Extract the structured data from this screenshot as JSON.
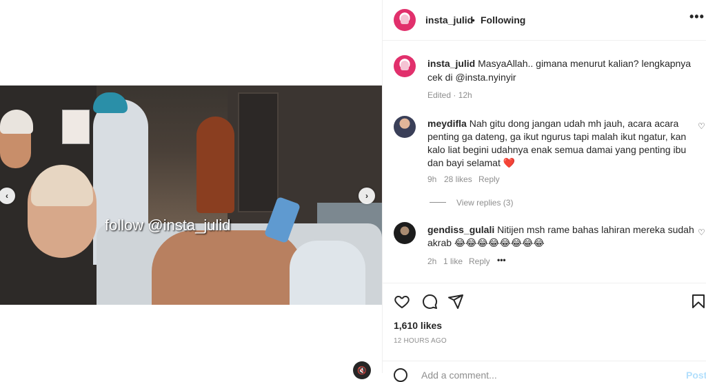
{
  "media": {
    "overlay_text": "follow @insta_julid",
    "prev_arrow": "‹",
    "next_arrow": "›",
    "audio_icon": "🔇"
  },
  "header": {
    "username": "insta_julid",
    "separator": "•",
    "following": "Following",
    "more": "•••"
  },
  "caption": {
    "username": "insta_julid",
    "text": "MasyaAllah.. gimana menurut kalian? lengkapnya cek di @insta.nyinyir",
    "meta": "Edited · 12h"
  },
  "comments": [
    {
      "username": "meydifla",
      "text": "Nah gitu dong jangan udah mh jauh, acara acara penting ga dateng, ga ikut ngurus tapi malah ikut ngatur, kan kalo liat begini udahnya enak semua damai yang penting ibu dan bayi selamat",
      "emoji": "❤️",
      "time": "9h",
      "likes": "28 likes",
      "reply": "Reply",
      "view_replies": "View replies (3)"
    },
    {
      "username": "gendiss_gulali",
      "text": "Nitijen msh rame bahas lahiran mereka sudah akrab",
      "emoji": "😂😂😂😂😂😂😂😂",
      "time": "2h",
      "likes": "1 like",
      "reply": "Reply",
      "more": "•••"
    }
  ],
  "footer": {
    "likes": "1,610 likes",
    "time_ago": "12 HOURS AGO",
    "add_comment_placeholder": "Add a comment...",
    "post": "Post"
  },
  "icons": {
    "like": "heart-icon",
    "comment": "comment-icon",
    "share": "share-icon",
    "save": "bookmark-icon"
  },
  "colors": {
    "accent": "#0095f6",
    "heart_red": "#ed4956",
    "muted": "#8e8e8e"
  }
}
